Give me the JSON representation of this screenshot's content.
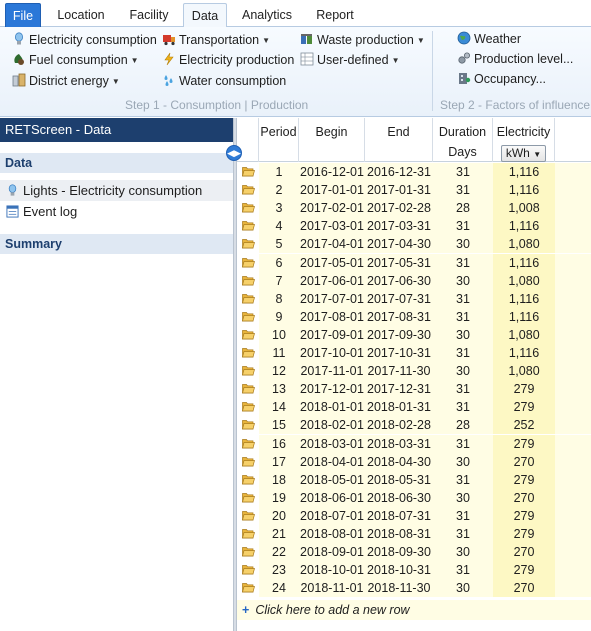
{
  "tabs": [
    {
      "label": "File"
    },
    {
      "label": "Location"
    },
    {
      "label": "Facility"
    },
    {
      "label": "Data"
    },
    {
      "label": "Analytics"
    },
    {
      "label": "Report"
    }
  ],
  "ribbon": {
    "step1": {
      "label": "Step 1 - Consumption | Production",
      "items": [
        {
          "label": "Electricity consumption",
          "icon": "lightbulb-icon",
          "dropdown": false
        },
        {
          "label": "Fuel consumption",
          "icon": "fuel-drop-icon",
          "dropdown": true
        },
        {
          "label": "District energy",
          "icon": "district-energy-icon",
          "dropdown": true
        },
        {
          "label": "Transportation",
          "icon": "truck-icon",
          "dropdown": true
        },
        {
          "label": "Electricity production",
          "icon": "lightning-icon",
          "dropdown": false
        },
        {
          "label": "Water consumption",
          "icon": "water-drops-icon",
          "dropdown": false
        },
        {
          "label": "Waste production",
          "icon": "waste-bin-icon",
          "dropdown": true
        },
        {
          "label": "User-defined",
          "icon": "user-defined-icon",
          "dropdown": true
        }
      ]
    },
    "step2": {
      "label": "Step 2 - Factors of influence",
      "items": [
        {
          "label": "Weather",
          "icon": "globe-icon"
        },
        {
          "label": "Production level...",
          "icon": "gears-icon"
        },
        {
          "label": "Occupancy...",
          "icon": "building-icon"
        }
      ]
    }
  },
  "left_panel": {
    "title": "RETScreen - Data",
    "data_section": "Data",
    "items": [
      {
        "label": "Lights - Electricity consumption",
        "icon": "lightbulb-icon"
      },
      {
        "label": "Event log",
        "icon": "event-log-icon"
      }
    ],
    "summary_section": "Summary"
  },
  "grid": {
    "headers": {
      "period": "Period",
      "begin": "Begin",
      "end": "End",
      "duration": "Duration",
      "duration_unit": "Days",
      "electricity": "Electricity",
      "electricity_unit": "kWh"
    },
    "rows": [
      {
        "period": "1",
        "begin": "2016-12-01",
        "end": "2016-12-31",
        "duration": "31",
        "electricity": "1,116"
      },
      {
        "period": "2",
        "begin": "2017-01-01",
        "end": "2017-01-31",
        "duration": "31",
        "electricity": "1,116"
      },
      {
        "period": "3",
        "begin": "2017-02-01",
        "end": "2017-02-28",
        "duration": "28",
        "electricity": "1,008"
      },
      {
        "period": "4",
        "begin": "2017-03-01",
        "end": "2017-03-31",
        "duration": "31",
        "electricity": "1,116"
      },
      {
        "period": "5",
        "begin": "2017-04-01",
        "end": "2017-04-30",
        "duration": "30",
        "electricity": "1,080"
      },
      {
        "period": "6",
        "begin": "2017-05-01",
        "end": "2017-05-31",
        "duration": "31",
        "electricity": "1,116"
      },
      {
        "period": "7",
        "begin": "2017-06-01",
        "end": "2017-06-30",
        "duration": "30",
        "electricity": "1,080"
      },
      {
        "period": "8",
        "begin": "2017-07-01",
        "end": "2017-07-31",
        "duration": "31",
        "electricity": "1,116"
      },
      {
        "period": "9",
        "begin": "2017-08-01",
        "end": "2017-08-31",
        "duration": "31",
        "electricity": "1,116"
      },
      {
        "period": "10",
        "begin": "2017-09-01",
        "end": "2017-09-30",
        "duration": "30",
        "electricity": "1,080"
      },
      {
        "period": "11",
        "begin": "2017-10-01",
        "end": "2017-10-31",
        "duration": "31",
        "electricity": "1,116"
      },
      {
        "period": "12",
        "begin": "2017-11-01",
        "end": "2017-11-30",
        "duration": "30",
        "electricity": "1,080"
      },
      {
        "period": "13",
        "begin": "2017-12-01",
        "end": "2017-12-31",
        "duration": "31",
        "electricity": "279"
      },
      {
        "period": "14",
        "begin": "2018-01-01",
        "end": "2018-01-31",
        "duration": "31",
        "electricity": "279"
      },
      {
        "period": "15",
        "begin": "2018-02-01",
        "end": "2018-02-28",
        "duration": "28",
        "electricity": "252"
      },
      {
        "period": "16",
        "begin": "2018-03-01",
        "end": "2018-03-31",
        "duration": "31",
        "electricity": "279"
      },
      {
        "period": "17",
        "begin": "2018-04-01",
        "end": "2018-04-30",
        "duration": "30",
        "electricity": "270"
      },
      {
        "period": "18",
        "begin": "2018-05-01",
        "end": "2018-05-31",
        "duration": "31",
        "electricity": "279"
      },
      {
        "period": "19",
        "begin": "2018-06-01",
        "end": "2018-06-30",
        "duration": "30",
        "electricity": "270"
      },
      {
        "period": "20",
        "begin": "2018-07-01",
        "end": "2018-07-31",
        "duration": "31",
        "electricity": "279"
      },
      {
        "period": "21",
        "begin": "2018-08-01",
        "end": "2018-08-31",
        "duration": "31",
        "electricity": "279"
      },
      {
        "period": "22",
        "begin": "2018-09-01",
        "end": "2018-09-30",
        "duration": "30",
        "electricity": "270"
      },
      {
        "period": "23",
        "begin": "2018-10-01",
        "end": "2018-10-31",
        "duration": "31",
        "electricity": "279"
      },
      {
        "period": "24",
        "begin": "2018-11-01",
        "end": "2018-11-30",
        "duration": "30",
        "electricity": "270"
      }
    ],
    "add_row_label": "Click here to add a new row"
  },
  "colors": {
    "file_tab": "#2b78d8",
    "panel_title": "#1d3f6e",
    "row_fill": "#fffde4",
    "electricity_fill": "#fdf8c4"
  }
}
